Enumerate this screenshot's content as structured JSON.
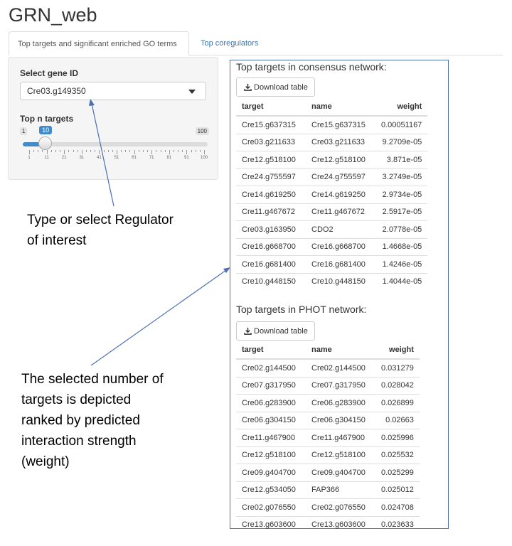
{
  "app": {
    "title": "GRN_web"
  },
  "tabs": [
    {
      "label": "Top targets and significant enriched GO terms",
      "active": true
    },
    {
      "label": "Top coregulators",
      "active": false
    }
  ],
  "sidebar": {
    "gene_label": "Select gene ID",
    "gene_value": "Cre03.g149350",
    "topn_label": "Top n targets",
    "slider": {
      "min": "1",
      "max": "100",
      "value": "10",
      "value_fraction": 0.09,
      "tick_labels": [
        "1",
        "11",
        "21",
        "31",
        "41",
        "51",
        "61",
        "71",
        "81",
        "91",
        "100"
      ]
    }
  },
  "annotations": {
    "regulator": [
      "Type or select Regulator",
      "of interest"
    ],
    "ranked": [
      "The selected number of",
      "targets is depicted",
      "ranked by predicted",
      "interaction strength",
      "(weight)"
    ]
  },
  "consensus": {
    "title": "Top targets in consensus network:",
    "download_label": "Download table",
    "columns": [
      "target",
      "name",
      "weight"
    ],
    "rows": [
      [
        "Cre15.g637315",
        "Cre15.g637315",
        "0.00051167"
      ],
      [
        "Cre03.g211633",
        "Cre03.g211633",
        "9.2709e-05"
      ],
      [
        "Cre12.g518100",
        "Cre12.g518100",
        "3.871e-05"
      ],
      [
        "Cre24.g755597",
        "Cre24.g755597",
        "3.2749e-05"
      ],
      [
        "Cre14.g619250",
        "Cre14.g619250",
        "2.9734e-05"
      ],
      [
        "Cre11.g467672",
        "Cre11.g467672",
        "2.5917e-05"
      ],
      [
        "Cre03.g163950",
        "CDO2",
        "2.0778e-05"
      ],
      [
        "Cre16.g668700",
        "Cre16.g668700",
        "1.4668e-05"
      ],
      [
        "Cre16.g681400",
        "Cre16.g681400",
        "1.4246e-05"
      ],
      [
        "Cre10.g448150",
        "Cre10.g448150",
        "1.4044e-05"
      ]
    ]
  },
  "phot": {
    "title": "Top targets in PHOT network:",
    "download_label": "Download table",
    "columns": [
      "target",
      "name",
      "weight"
    ],
    "rows": [
      [
        "Cre02.g144500",
        "Cre02.g144500",
        "0.031279"
      ],
      [
        "Cre07.g317950",
        "Cre07.g317950",
        "0.028042"
      ],
      [
        "Cre06.g283900",
        "Cre06.g283900",
        "0.026899"
      ],
      [
        "Cre06.g304150",
        "Cre06.g304150",
        "0.02663"
      ],
      [
        "Cre11.g467900",
        "Cre11.g467900",
        "0.025996"
      ],
      [
        "Cre12.g518100",
        "Cre12.g518100",
        "0.025532"
      ],
      [
        "Cre09.g404700",
        "Cre09.g404700",
        "0.025299"
      ],
      [
        "Cre12.g534050",
        "FAP366",
        "0.025012"
      ],
      [
        "Cre02.g076550",
        "Cre02.g076550",
        "0.024708"
      ],
      [
        "Cre13.g603600",
        "Cre13.g603600",
        "0.023633"
      ]
    ]
  },
  "colors": {
    "accent": "#428bca",
    "link": "#337ab7",
    "annotation_arrow": "#4a6fb5"
  },
  "icons": {
    "download": "download-icon",
    "dropdown": "caret-down-icon"
  }
}
